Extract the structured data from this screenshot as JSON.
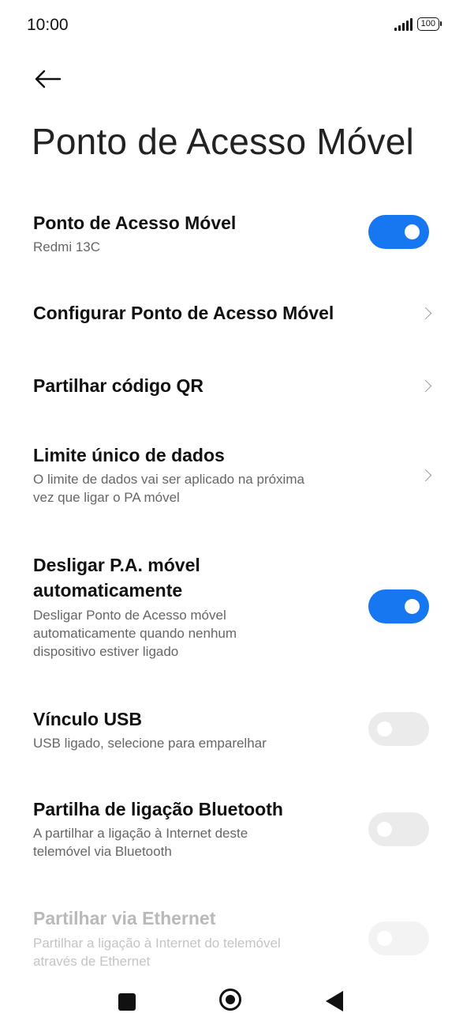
{
  "status_bar": {
    "time": "10:00",
    "battery": "100",
    "icons": [
      "signal-icon",
      "battery-icon"
    ]
  },
  "header": {
    "back_icon": "arrow-left-icon",
    "title": "Ponto de Acesso Móvel"
  },
  "settings": [
    {
      "title": "Ponto de Acesso Móvel",
      "subtitle": "Redmi 13C",
      "control": "toggle",
      "state": "on"
    },
    {
      "title": "Configurar Ponto de Acesso Móvel",
      "control": "chevron"
    },
    {
      "title": "Partilhar código QR",
      "control": "chevron"
    },
    {
      "title": "Limite único de dados",
      "subtitle_lines": [
        "O limite de dados vai ser aplicado na próxima",
        "vez que ligar o PA móvel"
      ],
      "control": "chevron"
    },
    {
      "title_lines": [
        "Desligar P.A. móvel",
        "automaticamente"
      ],
      "subtitle_lines": [
        "Desligar Ponto de Acesso móvel",
        "automaticamente quando nenhum",
        "dispositivo estiver ligado"
      ],
      "control": "toggle",
      "state": "on"
    },
    {
      "title": "Vínculo USB",
      "subtitle": "USB ligado, selecione para emparelhar",
      "control": "toggle",
      "state": "off"
    },
    {
      "title": "Partilha de ligação Bluetooth",
      "subtitle_lines": [
        "A partilhar a ligação à Internet deste",
        "telemóvel via Bluetooth"
      ],
      "control": "toggle",
      "state": "off"
    },
    {
      "title": "Partilhar via Ethernet",
      "subtitle_lines": [
        "Partilhar a ligação à Internet do telemóvel",
        "através de Ethernet"
      ],
      "control": "toggle",
      "state": "disabled"
    }
  ],
  "colors": {
    "accent": "#1677f0",
    "toggle_off": "#ebebeb",
    "subtitle": "#666666",
    "disabled_text": "#b9b9b9"
  },
  "nav_bar": {
    "icons": [
      "recents-square-icon",
      "home-circle-icon",
      "back-triangle-icon"
    ]
  }
}
